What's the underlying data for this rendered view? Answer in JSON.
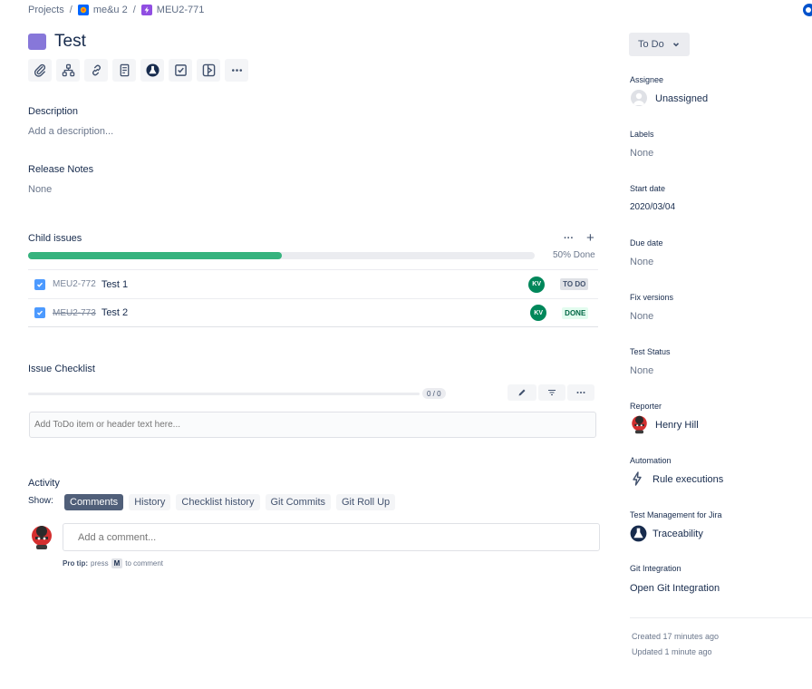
{
  "breadcrumb": {
    "projects": "Projects",
    "separator": "/",
    "project": "me&u 2",
    "issue_key": "MEU2-771"
  },
  "issue": {
    "title": "Test",
    "type_color": "#8777d9"
  },
  "toolbar": {
    "icons": [
      "paperclip-icon",
      "hierarchy-icon",
      "link-icon",
      "page-icon",
      "flask-icon",
      "checkbox-icon",
      "split-icon",
      "more-icon"
    ]
  },
  "description": {
    "label": "Description",
    "placeholder": "Add a description..."
  },
  "release_notes": {
    "label": "Release Notes",
    "value": "None"
  },
  "child_issues": {
    "label": "Child issues",
    "more": "···",
    "add": "+",
    "progress_percent": 50,
    "progress_text": "50% Done",
    "items": [
      {
        "key": "MEU2-772",
        "summary": "Test 1",
        "avatar": "KV",
        "status": "TO DO",
        "done": false
      },
      {
        "key": "MEU2-773",
        "summary": "Test 2",
        "avatar": "KV",
        "status": "DONE",
        "done": true
      }
    ]
  },
  "checklist": {
    "label": "Issue Checklist",
    "count": "0 / 0",
    "progress_percent": 0,
    "placeholder": "Add ToDo item or header text here..."
  },
  "activity": {
    "label": "Activity",
    "show": "Show:",
    "tabs": [
      "Comments",
      "History",
      "Checklist history",
      "Git Commits",
      "Git Roll Up"
    ],
    "active_tab": 0,
    "comment_placeholder": "Add a comment...",
    "protip_bold": "Pro tip:",
    "protip_press": "press",
    "protip_key": "M",
    "protip_rest": "to comment"
  },
  "sidebar": {
    "status_button": "To Do",
    "assignee": {
      "label": "Assignee",
      "value": "Unassigned"
    },
    "labels": {
      "label": "Labels",
      "value": "None"
    },
    "start_date": {
      "label": "Start date",
      "value": "2020/03/04"
    },
    "due_date": {
      "label": "Due date",
      "value": "None"
    },
    "fix_versions": {
      "label": "Fix versions",
      "value": "None"
    },
    "test_status": {
      "label": "Test Status",
      "value": "None"
    },
    "reporter": {
      "label": "Reporter",
      "value": "Henry Hill"
    },
    "automation": {
      "label": "Automation",
      "value": "Rule executions"
    },
    "test_management": {
      "label": "Test Management for Jira",
      "value": "Traceability"
    },
    "git": {
      "label": "Git Integration",
      "value": "Open Git Integration"
    },
    "created": "Created 17 minutes ago",
    "updated": "Updated 1 minute ago"
  },
  "colors": {
    "progress_green": "#36b37e",
    "avatar_green": "#00875a",
    "primary_dark": "#505f79",
    "checkbox_blue": "#4c9aff"
  }
}
